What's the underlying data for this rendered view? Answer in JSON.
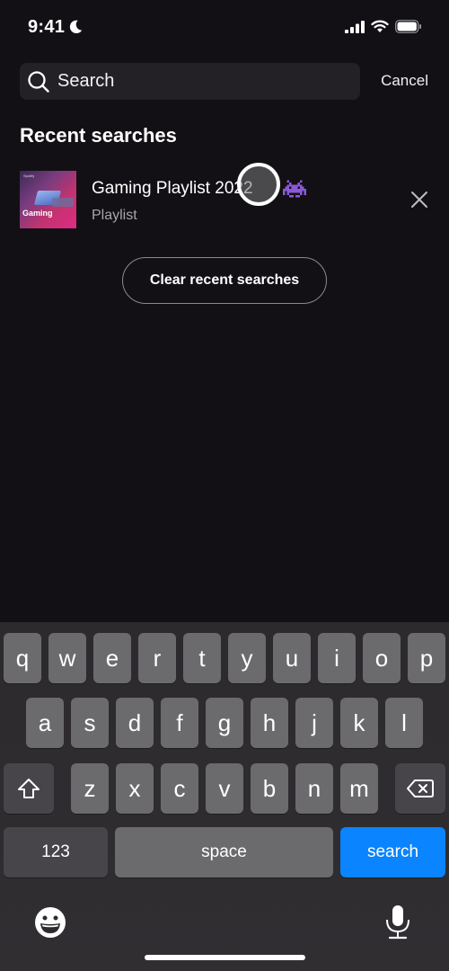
{
  "status_bar": {
    "time": "9:41",
    "icons": [
      "moon-icon",
      "cellular-signal-icon",
      "wifi-icon",
      "battery-icon"
    ]
  },
  "search": {
    "placeholder": "Search",
    "value": "",
    "cancel_label": "Cancel",
    "icon": "search-icon"
  },
  "recent": {
    "title": "Recent searches",
    "items": [
      {
        "title": "Gaming Playlist 2022",
        "emoji": "space-invader-icon",
        "subtitle": "Playlist",
        "thumb_label": "Gaming",
        "thumb_brand": "Spotify",
        "remove_icon": "close-icon"
      }
    ],
    "clear_label": "Clear recent searches"
  },
  "keyboard": {
    "row1": [
      "q",
      "w",
      "e",
      "r",
      "t",
      "y",
      "u",
      "i",
      "o",
      "p"
    ],
    "row2": [
      "a",
      "s",
      "d",
      "f",
      "g",
      "h",
      "j",
      "k",
      "l"
    ],
    "row3": [
      "z",
      "x",
      "c",
      "v",
      "b",
      "n",
      "m"
    ],
    "numbers_label": "123",
    "space_label": "space",
    "search_label": "search",
    "accent_color": "#0a84ff"
  }
}
